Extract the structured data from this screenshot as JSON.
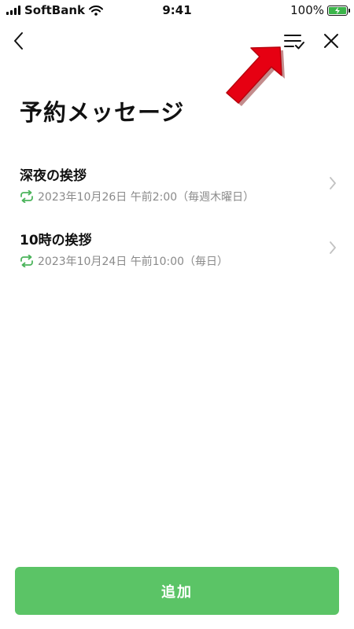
{
  "status_bar": {
    "carrier": "SoftBank",
    "time": "9:41",
    "battery_percent": "100%",
    "battery_color": "#3bb54a"
  },
  "nav": {
    "back_icon": "chevron-left-icon",
    "select_icon": "list-check-icon",
    "close_icon": "close-icon"
  },
  "page": {
    "title": "予約メッセージ"
  },
  "messages": [
    {
      "title": "深夜の挨拶",
      "schedule": "2023年10月26日 午前2:00（毎週木曜日）",
      "repeat_icon": "repeat-icon"
    },
    {
      "title": "10時の挨拶",
      "schedule": "2023年10月24日 午前10:00（毎日）",
      "repeat_icon": "repeat-icon"
    }
  ],
  "footer": {
    "add_label": "追加",
    "accent_color": "#5bc466"
  },
  "annotation": {
    "arrow_color": "#e60012",
    "arrow_icon": "pointer-arrow-icon"
  }
}
